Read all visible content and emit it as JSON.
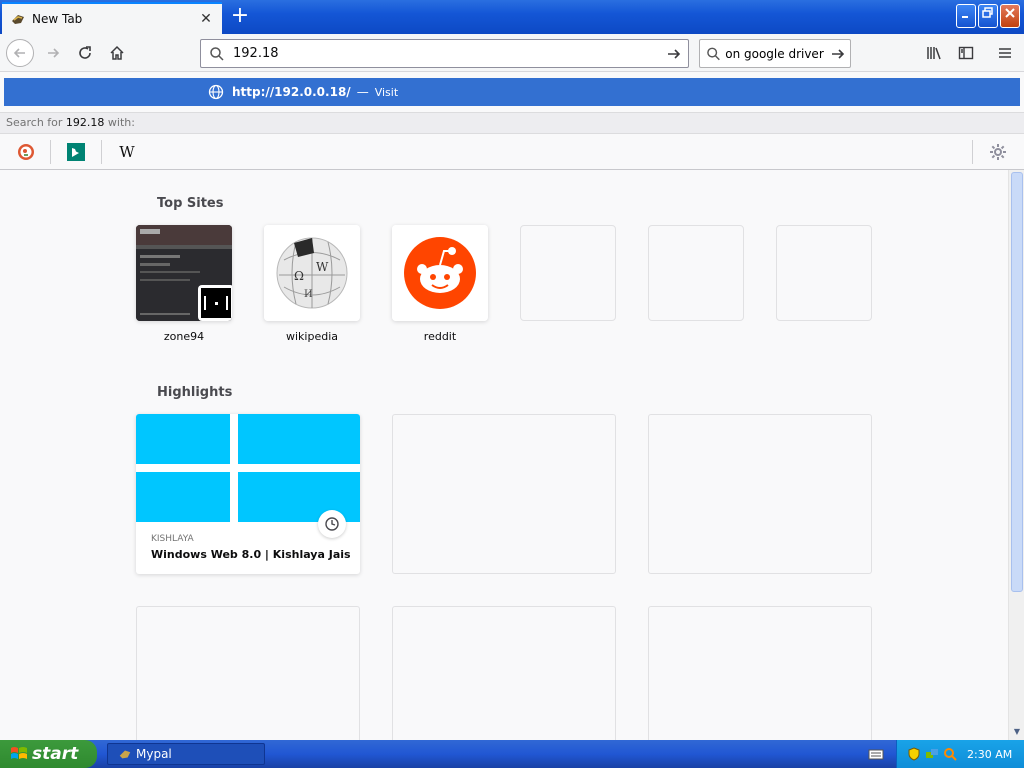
{
  "browser": {
    "tab_title": "New Tab",
    "new_tab_symbol": "+",
    "window_buttons": {
      "minimize": "_",
      "restore": "❐",
      "close": "✕"
    }
  },
  "nav": {
    "url_value": "192.18",
    "search_value": "on google driver"
  },
  "dropdown": {
    "suggestion_url": "http://192.0.0.18/",
    "suggestion_sep": "—",
    "suggestion_action": "Visit",
    "search_for_prefix": "Search for",
    "search_for_query": "192.18",
    "search_for_suffix": "with:",
    "engines": [
      "duckduckgo-icon",
      "bing-icon",
      "wikipedia-icon"
    ],
    "wikipedia_letter": "W"
  },
  "content": {
    "top_sites_title": "Top Sites",
    "top_sites": [
      {
        "label": "zone94"
      },
      {
        "label": "wikipedia"
      },
      {
        "label": "reddit"
      }
    ],
    "highlights_title": "Highlights",
    "highlight_card": {
      "source": "KISHLAYA",
      "title": "Windows Web 8.0 | Kishlaya Jais..."
    }
  },
  "taskbar": {
    "start_label": "start",
    "task_label": "Mypal",
    "clock": "2:30 AM"
  },
  "colors": {
    "accent": "#0a84ff",
    "suggest_bg": "#3370d1",
    "reddit": "#ff4500",
    "windows_blue": "#00c6ff"
  }
}
